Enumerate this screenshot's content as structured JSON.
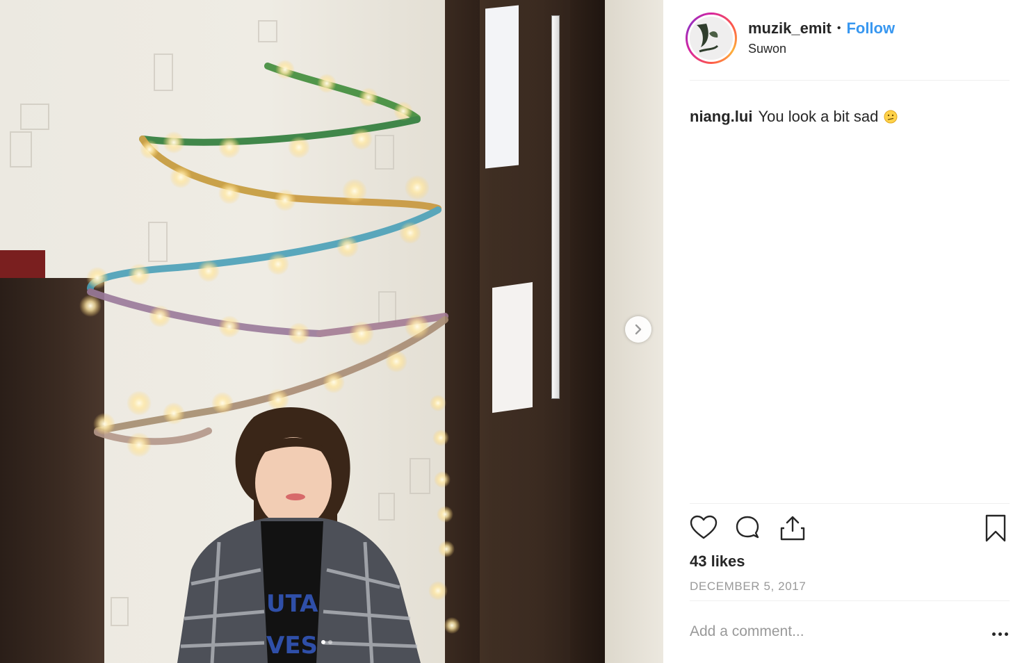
{
  "post": {
    "username": "muzik_emit",
    "separator": "•",
    "follow_label": "Follow",
    "location": "Suwon",
    "likes_text": "43 likes",
    "date_text": "DECEMBER 5, 2017"
  },
  "comments": [
    {
      "user": "niang.lui",
      "text": "You look a bit sad",
      "emoji": "confused-face-icon"
    }
  ],
  "composer": {
    "placeholder": "Add a comment..."
  },
  "carousel": {
    "current_slide": 1,
    "total_slides": 2
  },
  "colors": {
    "follow_blue": "#3897f0",
    "text_dark": "#262626",
    "text_muted": "#999999"
  }
}
